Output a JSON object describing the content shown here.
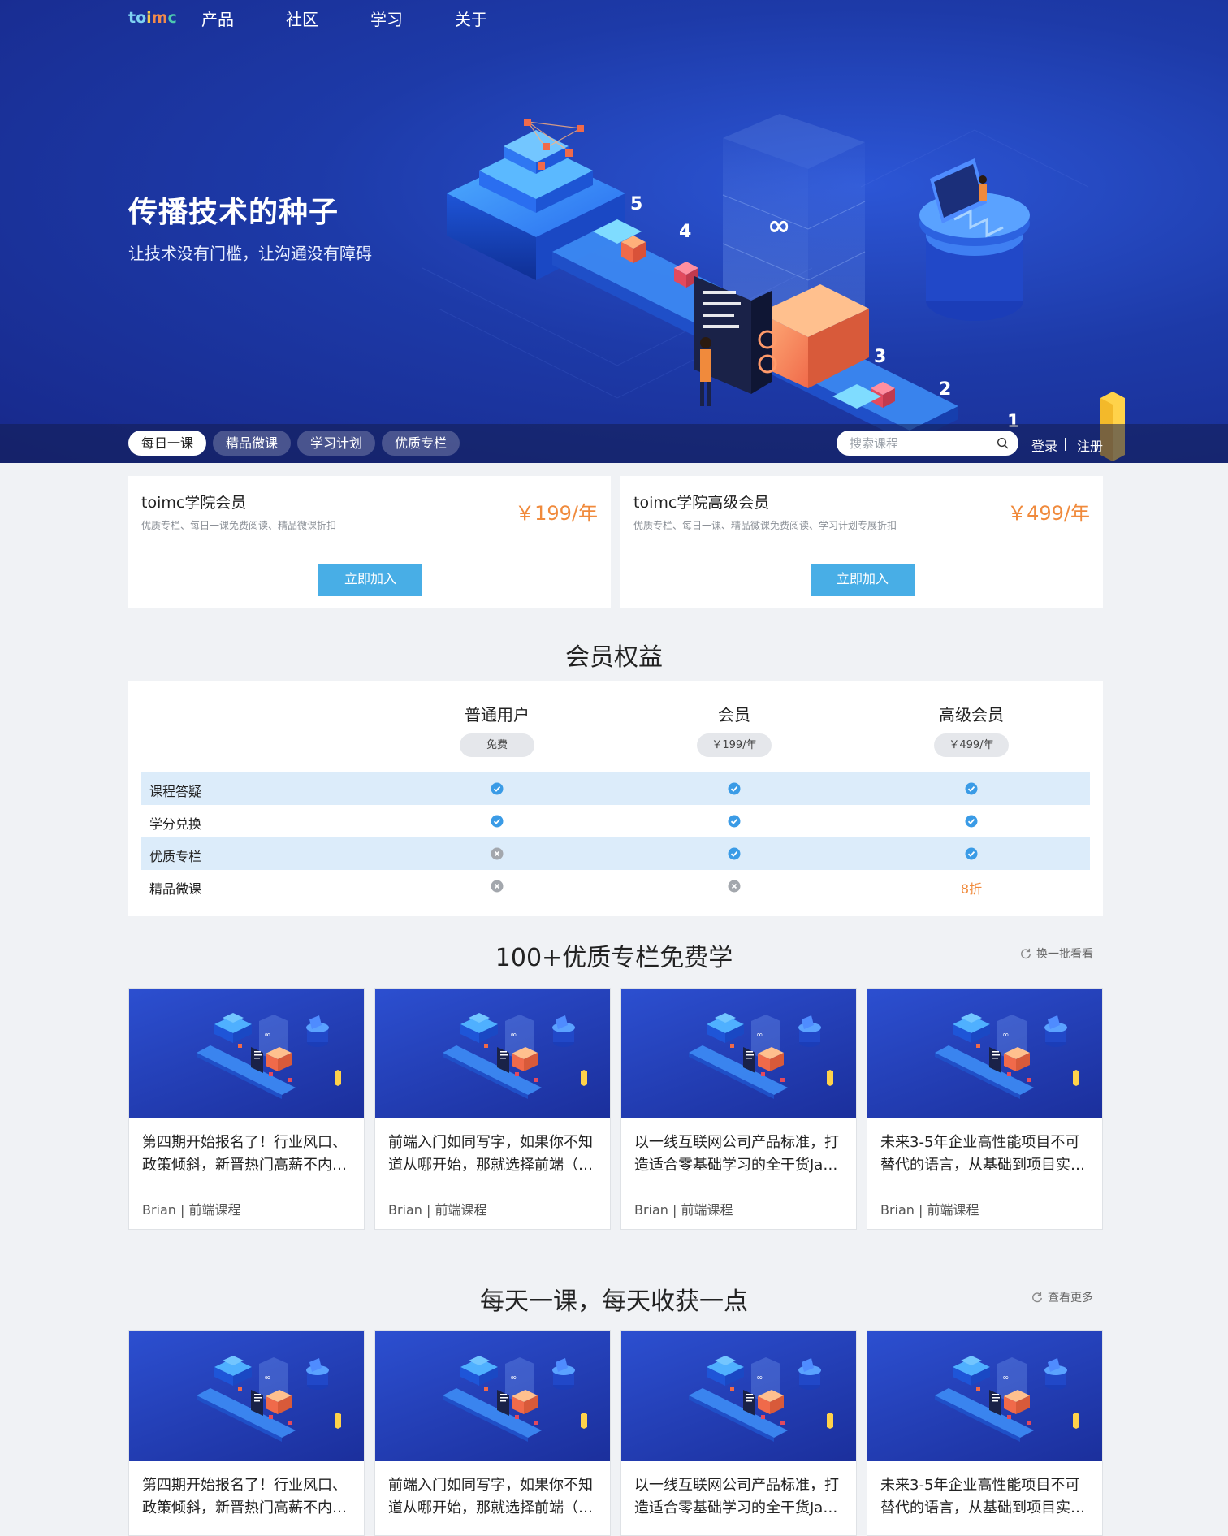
{
  "nav": {
    "logo": [
      "to",
      "i",
      "m",
      "c"
    ],
    "links": [
      "产品",
      "社区",
      "学习",
      "关于"
    ]
  },
  "hero": {
    "title": "传播技术的种子",
    "subtitle": "让技术没有门槛，让沟通没有障碍",
    "art_numbers": [
      "5",
      "4",
      "3",
      "2",
      "1"
    ]
  },
  "subnav": {
    "tabs": [
      "每日一课",
      "精品微课",
      "学习计划",
      "优质专栏"
    ],
    "active_tab": "每日一课",
    "search_placeholder": "搜索课程",
    "login": "登录",
    "separator": "|",
    "register": "注册"
  },
  "memberships": [
    {
      "title": "toimc学院会员",
      "desc": "优质专栏、每日一课免费阅读、精品微课折扣",
      "price": "￥199/年",
      "button": "立即加入"
    },
    {
      "title": "toimc学院高级会员",
      "desc": "优质专栏、每日一课、精品微课免费阅读、学习计划专展折扣",
      "price": "￥499/年",
      "button": "立即加入"
    }
  ],
  "benefits": {
    "title": "会员权益",
    "plans": [
      {
        "name": "普通用户",
        "price": "免费"
      },
      {
        "name": "会员",
        "price": "￥199/年"
      },
      {
        "name": "高级会员",
        "price": "￥499/年"
      }
    ],
    "rows": [
      {
        "label": "课程答疑",
        "values": [
          "check",
          "check",
          "check"
        ]
      },
      {
        "label": "学分兑换",
        "values": [
          "check",
          "check",
          "check"
        ]
      },
      {
        "label": "优质专栏",
        "values": [
          "cross",
          "check",
          "check"
        ]
      },
      {
        "label": "精品微课",
        "values": [
          "cross",
          "cross",
          "8折"
        ]
      }
    ]
  },
  "columns_section": {
    "title": "100+优质专栏免费学",
    "more": "换一批看看",
    "cards": [
      {
        "title": "第四期开始报名了！行业风口、政策倾斜，新晋热门高薪不内…",
        "author": "Brian",
        "category": "前端课程"
      },
      {
        "title": "前端入门如同写字，如果你不知道从哪开始，那就选择前端（…",
        "author": "Brian",
        "category": "前端课程"
      },
      {
        "title": "以一线互联网公司产品标准，打造适合零基础学习的全干货Ja…",
        "author": "Brian",
        "category": "前端课程"
      },
      {
        "title": "未来3-5年企业高性能项目不可替代的语言，从基础到项目实…",
        "author": "Brian",
        "category": "前端课程"
      }
    ]
  },
  "daily_section": {
    "title": "每天一课，每天收获一点",
    "more": "查看更多",
    "cards": [
      {
        "title": "第四期开始报名了！行业风口、政策倾斜，新晋热门高薪不内…"
      },
      {
        "title": "前端入门如同写字，如果你不知道从哪开始，那就选择前端（…"
      },
      {
        "title": "以一线互联网公司产品标准，打造适合零基础学习的全干货Ja…"
      },
      {
        "title": "未来3-5年企业高性能项目不可替代的语言，从基础到项目实…"
      }
    ]
  },
  "colors": {
    "accent_blue": "#48aee6",
    "price_orange": "#f08a3c",
    "hero_blue": "#1d3aa8",
    "row_highlight": "#dcecfa"
  }
}
